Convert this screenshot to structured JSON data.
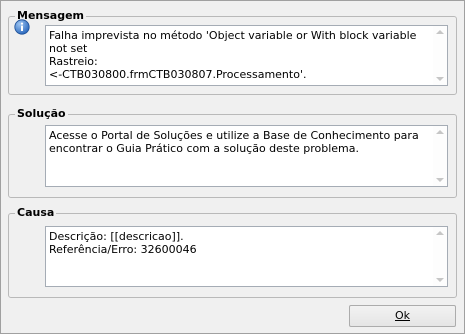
{
  "groups": {
    "mensagem": {
      "title": "Mensagem",
      "text": "Falha imprevista no método 'Object variable or With block variable not set\nRastreio:\n<-CTB030800.frmCTB030807.Processamento'."
    },
    "solucao": {
      "title": "Solução",
      "text": "Acesse o Portal de Soluções e utilize a Base de Conhecimento para encontrar o Guia Prático com a solução deste problema."
    },
    "causa": {
      "title": "Causa",
      "text": "Descrição: [[descricao]].\nReferência/Erro: 32600046"
    }
  },
  "buttons": {
    "ok": "Ok"
  },
  "icons": {
    "info": "info-icon"
  }
}
